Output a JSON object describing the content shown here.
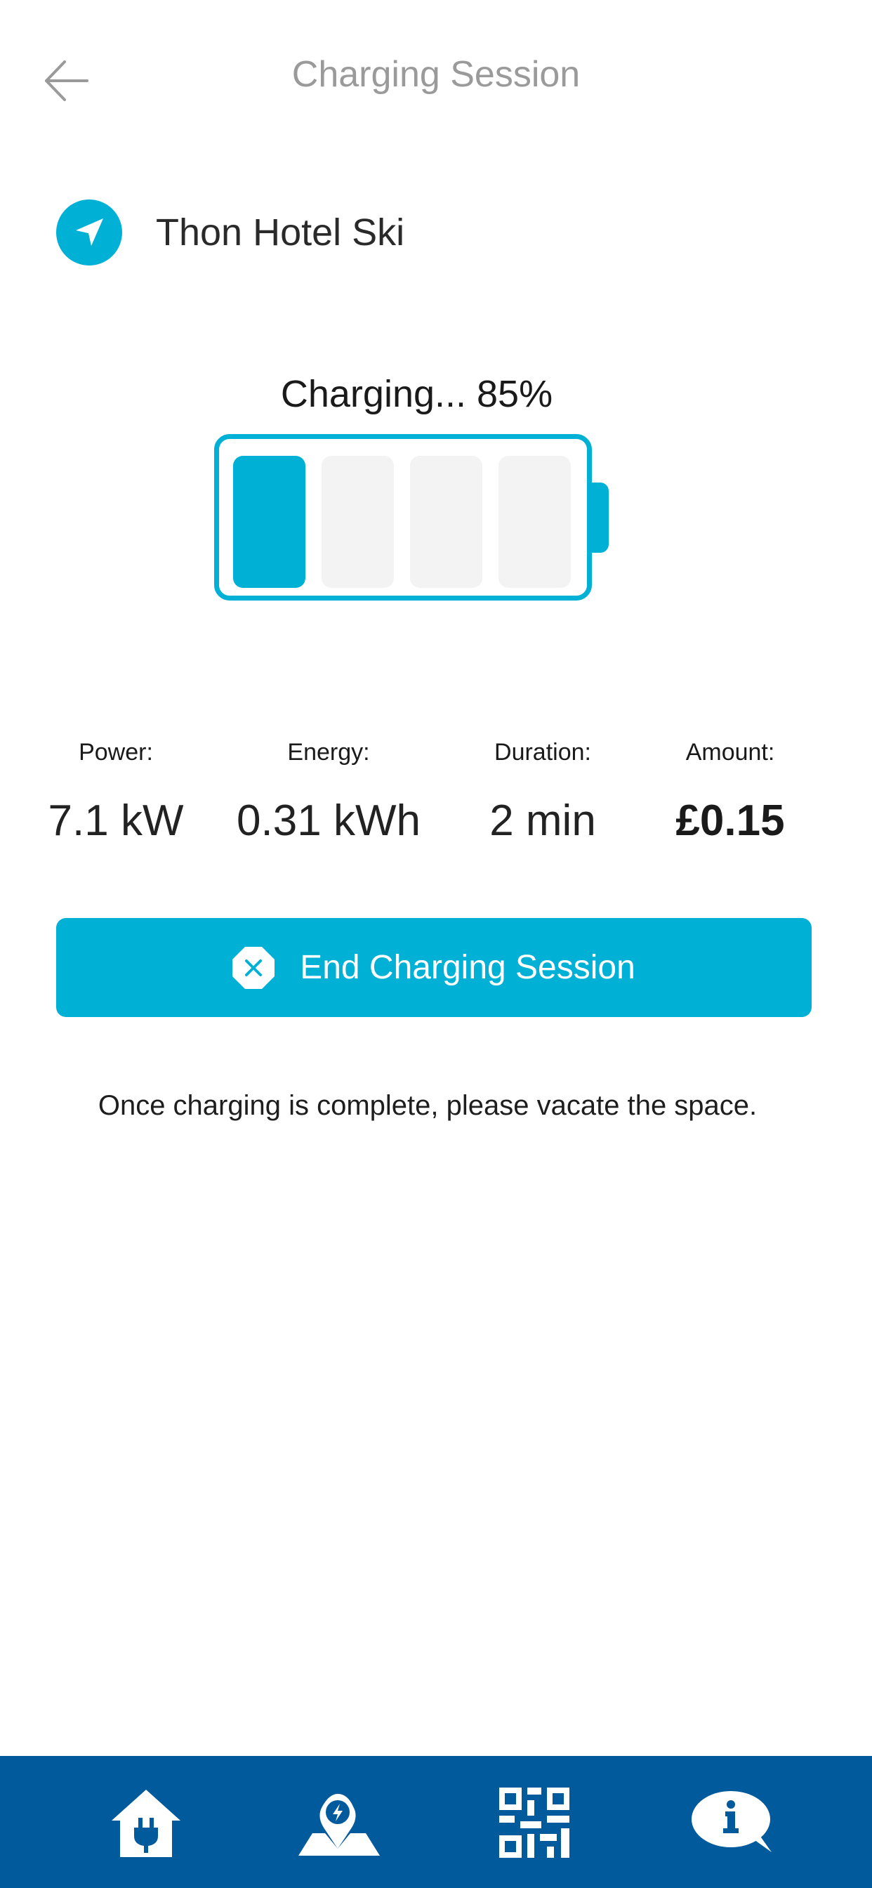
{
  "header": {
    "title": "Charging Session",
    "back_icon": "arrow-left-icon"
  },
  "location": {
    "name": "Thon Hotel Ski",
    "icon": "navigation-arrow-icon"
  },
  "charging": {
    "status_text": "Charging... 85%",
    "percent": 85,
    "cells_total": 4,
    "cells_filled": 1
  },
  "stats": [
    {
      "label": "Power:",
      "value": "7.1 kW"
    },
    {
      "label": "Energy:",
      "value": "0.31 kWh"
    },
    {
      "label": "Duration:",
      "value": "2 min"
    },
    {
      "label": "Amount:",
      "value": "£0.15"
    }
  ],
  "end_button": {
    "label": "End Charging Session",
    "icon": "close-circle-icon"
  },
  "note": "Once charging is complete, please vacate the space.",
  "bottom_nav": {
    "items": [
      {
        "icon": "home-plug-icon"
      },
      {
        "icon": "map-pin-icon"
      },
      {
        "icon": "qr-code-icon"
      },
      {
        "icon": "info-bubble-icon"
      }
    ]
  },
  "colors": {
    "accent": "#00b0d5",
    "nav_bg": "#005a9c",
    "title_grey": "#9a9a9a",
    "cell_empty": "#f3f3f3"
  }
}
